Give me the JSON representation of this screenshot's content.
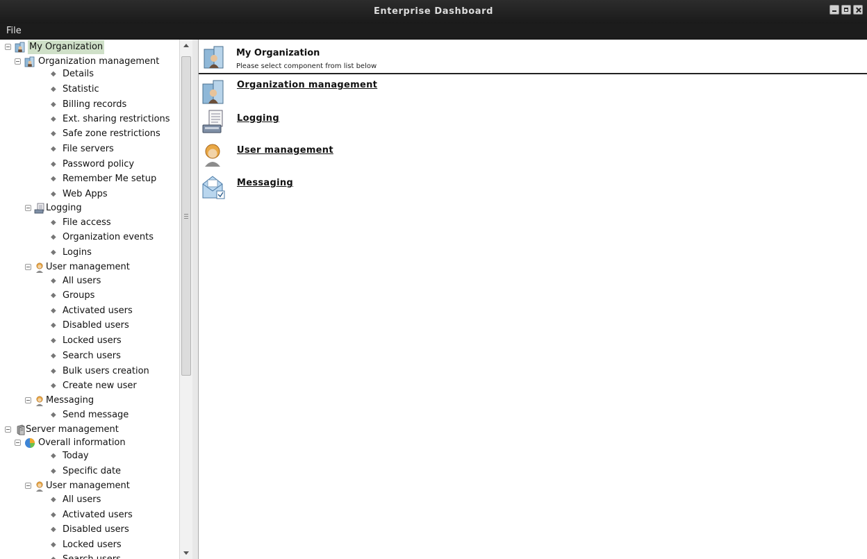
{
  "window": {
    "title": "Enterprise Dashboard"
  },
  "menu": {
    "file": "File"
  },
  "tree": {
    "my_org": "My Organization",
    "org_mgmt": "Organization management",
    "org_items": [
      "Details",
      "Statistic",
      "Billing records",
      "Ext. sharing restrictions",
      "Safe zone restrictions",
      "File servers",
      "Password policy",
      "Remember Me setup",
      "Web Apps"
    ],
    "logging": "Logging",
    "logging_items": [
      "File access",
      "Organization events",
      "Logins"
    ],
    "user_mgmt": "User management",
    "user_items": [
      "All users",
      "Groups",
      "Activated users",
      "Disabled users",
      "Locked users",
      "Search users",
      "Bulk users creation",
      "Create new user"
    ],
    "messaging": "Messaging",
    "messaging_items": [
      "Send message"
    ],
    "server_mgmt": "Server management",
    "overall_info": "Overall information",
    "overall_items": [
      "Today",
      "Specific date"
    ],
    "server_user_mgmt": "User management",
    "server_user_items": [
      "All users",
      "Activated users",
      "Disabled users",
      "Locked users",
      "Search users"
    ]
  },
  "content": {
    "title": "My Organization",
    "subtitle": "Please select component from list below",
    "components": [
      "Organization management",
      "Logging",
      "User management",
      "Messaging"
    ]
  },
  "icons": [
    "building-person-icon",
    "document-printer-icon",
    "user-icon",
    "envelope-icon",
    "server-icon",
    "pie-chart-icon"
  ]
}
